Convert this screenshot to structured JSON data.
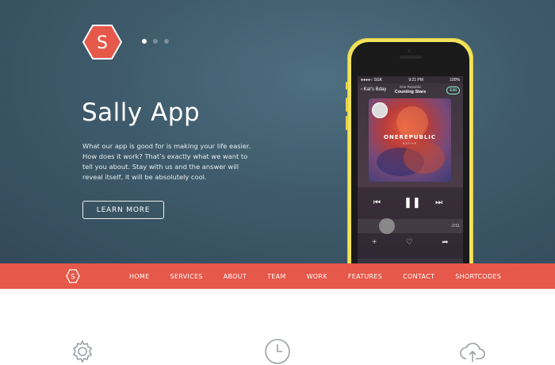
{
  "hero": {
    "logo_letter": "S",
    "title": "Sally App",
    "description": "What our app is good for is making your life easier. How does it work? That’s exactly what we want to tell you about. Stay with us and the answer will reveal itself, it will be absolutely cool.",
    "button_label": "LEARN MORE",
    "slides": 3,
    "active_slide": 1
  },
  "phone": {
    "status_left": "●●●●○ SGK",
    "status_time": "9:21 PM",
    "status_right": "100%",
    "back_label": "Kat’s Bday",
    "artist": "One Republic",
    "song": "Counting Stars",
    "edit_label": "Edit",
    "album_band": "ONEREPUBLIC",
    "album_sub": "NATIVE",
    "time_remaining": "-2:51",
    "progress": 0.2
  },
  "menu": {
    "logo_letter": "S",
    "items": [
      "HOME",
      "SERVICES",
      "ABOUT",
      "TEAM",
      "WORK",
      "FEATURES",
      "CONTACT",
      "SHORTCODES"
    ]
  },
  "features": [
    "gear-icon",
    "clock-icon",
    "cloud-upload-icon"
  ],
  "colors": {
    "accent": "#e5584a",
    "hero_bg": "#3f5b6b",
    "phone_body": "#f3e35a"
  }
}
